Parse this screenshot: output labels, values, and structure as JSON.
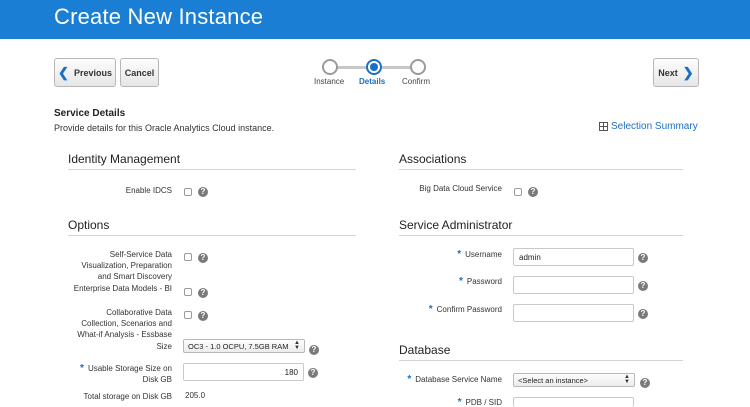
{
  "page": {
    "title": "Create New Instance"
  },
  "nav": {
    "previous_label": "Previous",
    "cancel_label": "Cancel",
    "next_label": "Next"
  },
  "train": {
    "steps": [
      {
        "label": "Instance",
        "state": "visited"
      },
      {
        "label": "Details",
        "state": "current"
      },
      {
        "label": "Confirm",
        "state": "pending"
      }
    ]
  },
  "service_details": {
    "title": "Service Details",
    "description": "Provide details for this Oracle Analytics Cloud instance.",
    "summary_link": "Selection Summary",
    "summary_icon": "table-icon"
  },
  "identity": {
    "title": "Identity Management",
    "enable_idcs_label": "Enable IDCS",
    "enable_idcs_checked": false
  },
  "options": {
    "title": "Options",
    "ssdv_label_lines": [
      "Self-Service Data",
      "Visualization, Preparation",
      "and Smart Discovery"
    ],
    "edm_label": "Enterprise Data Models - BI",
    "essbase_label_lines": [
      "Collaborative Data",
      "Collection, Scenarios and",
      "What-if Analysis - Essbase"
    ],
    "size_label": "Size",
    "size_value": "OC3 - 1.0 OCPU, 7.5GB RAM",
    "storage_label_lines": [
      "Usable Storage Size on",
      "Disk GB"
    ],
    "storage_value": "180",
    "total_storage_label": "Total storage on Disk GB",
    "total_storage_value": "205.0"
  },
  "associations": {
    "title": "Associations",
    "bdcs_label": "Big Data Cloud Service"
  },
  "admin": {
    "title": "Service Administrator",
    "username_label": "Username",
    "username_value": "admin",
    "password_label": "Password",
    "confirm_password_label": "Confirm Password"
  },
  "database": {
    "title": "Database",
    "service_name_label": "Database Service Name",
    "service_name_value": "<Select an instance>",
    "pdb_label": "PDB / SID"
  },
  "help_glyph": "?",
  "required_glyph": "*",
  "colors": {
    "header": "#1a7fd4",
    "accent": "#1a6fc4"
  }
}
